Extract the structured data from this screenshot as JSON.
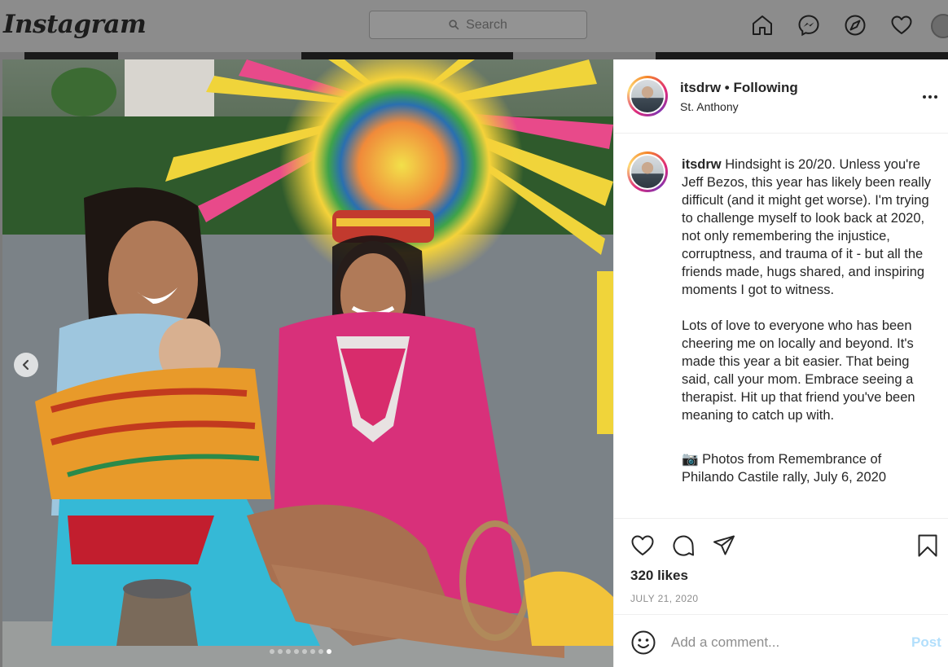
{
  "app": {
    "logo_text": "Instagram",
    "search_placeholder": "Search",
    "nav_icons": [
      "home-icon",
      "messenger-icon",
      "explore-icon",
      "activity-heart-icon",
      "profile-avatar"
    ]
  },
  "post": {
    "username": "itsdrw",
    "follow_status": "Following",
    "separator": "•",
    "location": "St. Anthony",
    "caption_para1": "Hindsight is 20/20. Unless you're Jeff Bezos, this year has likely been really difficult (and it might get worse). I'm trying to challenge myself to look back at 2020, not only remembering the injustice, corruptness, and trauma of it - but all the friends made, hugs shared, and inspiring moments I got to witness.",
    "caption_para2": "Lots of love to everyone who has been cheering me on locally and beyond. It's made this year a bit easier. That being said, call your mom. Embrace seeing a therapist. Hit up that friend you've been meaning to catch up with.",
    "caption_para3": "📷 Photos from Remembrance of Philando Castile rally, July 6, 2020",
    "likes": "320 likes",
    "date": "JULY 21, 2020",
    "carousel": {
      "total": 8,
      "active_index": 7
    },
    "comment_placeholder": "Add a comment...",
    "post_button": "Post"
  },
  "colors": {
    "post_button_disabled": "#b2dffc",
    "story_ring": [
      "#f58529",
      "#dd2a7b",
      "#8134af",
      "#feda77"
    ],
    "text_primary": "#262626",
    "text_secondary": "#8e8e8e"
  }
}
